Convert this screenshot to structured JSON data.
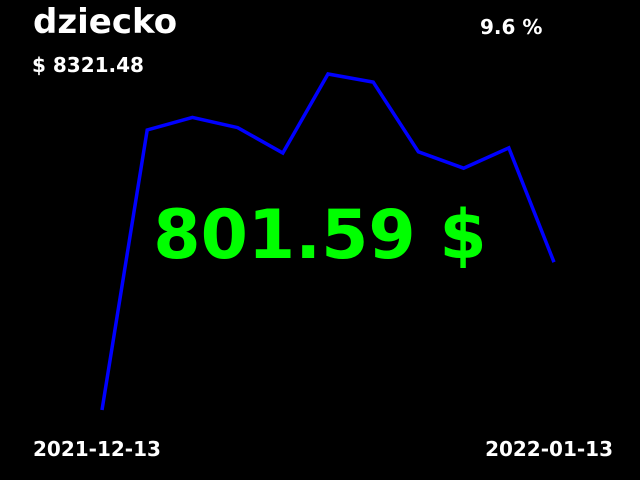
{
  "header": {
    "title": "dziecko",
    "change": "9.6 %",
    "total": "$ 8321.48"
  },
  "current_value": "801.59 $",
  "colors": {
    "background": "#000000",
    "text": "#ffffff",
    "line": "#0000ff",
    "current_value": "#00ff00"
  },
  "dates": {
    "start": "2021-12-13",
    "end": "2022-01-13"
  },
  "chart_data": {
    "type": "line",
    "title": "dziecko",
    "xlabel": "",
    "ylabel": "",
    "grid": false,
    "legend": "none",
    "x": [
      0,
      1,
      2,
      3,
      4,
      5,
      6,
      7,
      8,
      9,
      10
    ],
    "values": [
      731.5,
      825.1,
      829.3,
      825.9,
      817.4,
      843.8,
      841.1,
      817.8,
      812.3,
      819.1,
      780.9
    ],
    "ylim": [
      731.5,
      843.8
    ],
    "x_tick_labels": [
      "2021-12-13",
      "2022-01-13"
    ]
  }
}
